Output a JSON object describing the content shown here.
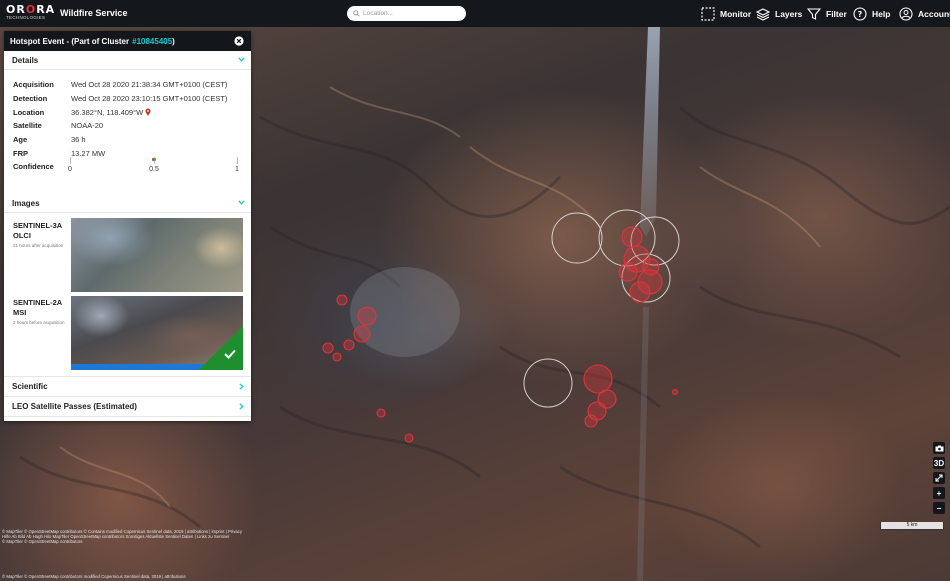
{
  "brand": {
    "logo_text_a": "OR",
    "logo_text_accent": "O",
    "logo_text_b": "RA",
    "logo_subtitle": "TECHNOLOGIES",
    "app_title": "Wildfire Service"
  },
  "search": {
    "placeholder": "Location...",
    "icon": "search-icon"
  },
  "nav": [
    {
      "label": "Monitor",
      "icon": "monitor-frame-icon"
    },
    {
      "label": "Layers",
      "icon": "layers-icon"
    },
    {
      "label": "Filter",
      "icon": "filter-icon"
    },
    {
      "label": "Help",
      "icon": "help-icon"
    },
    {
      "label": "Account",
      "icon": "account-icon"
    }
  ],
  "panel": {
    "title": "Hotspot Event - (Part of Cluster",
    "cluster_id": "#10845405",
    "title_close": ")",
    "details_label": "Details",
    "details": {
      "acquisition_label": "Acquisition",
      "acquisition": "Wed Oct 28 2020 21:38:34 GMT+0100 (CEST)",
      "detection_label": "Detection",
      "detection": "Wed Oct 28 2020 23:10:15 GMT+0100 (CEST)",
      "location_label": "Location",
      "location": "36.382°N, 118.409°W",
      "satellite_label": "Satellite",
      "satellite": "NOAA-20",
      "age_label": "Age",
      "age": "36 h",
      "frp_label": "FRP",
      "frp": "13.27 MW",
      "confidence_label": "Confidence",
      "confidence_value": 0.5,
      "confidence_min": "0",
      "confidence_mid": "0.5",
      "confidence_max": "1"
    },
    "images_label": "Images",
    "images": [
      {
        "satellite": "SENTINEL-3A",
        "instrument": "OLCI",
        "note": "21 hours after acquisition"
      },
      {
        "satellite": "SENTINEL-2A",
        "instrument": "MSI",
        "note": "2 hours before acquisition"
      }
    ],
    "scientific_label": "Scientific",
    "leo_label": "LEO Satellite Passes (Estimated)"
  },
  "map": {
    "controls": {
      "camera": "camera-icon",
      "three_d": "3D",
      "expand": "expand-icon",
      "zoom_in": "+",
      "zoom_out": "−"
    },
    "scale_label": "5 km",
    "attribution": "© MapTiler © OpenStreetMap contributors © Contains modified Copernicus Sentinel data, 2019 | attributions | imprint | Privacy",
    "attribution_line2": "Hilfe Ab Bild Ab Hagh Hilo MapTiler OpenStreetMap contributors Sonstiges Aktuellste Sentinel Daten | Links zu Sentinel",
    "attribution_line3": "© MapTiler © OpenStreetMap contributors",
    "attribution_bottom": "© MapTiler © OpenStreetMap contributors modified Copernicus Sentinel data, 2019 | attributions",
    "colors": {
      "hotspot": "#e0333c",
      "smoke_plume": "#a9b6c6"
    }
  }
}
